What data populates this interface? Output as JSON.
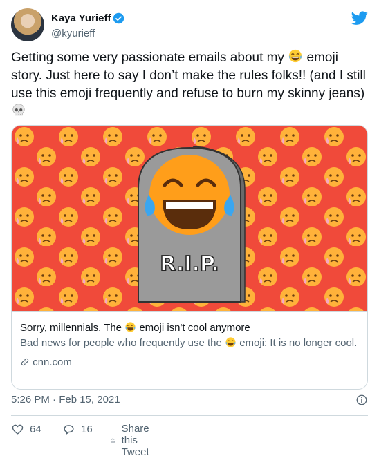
{
  "author": {
    "name": "Kaya Yurieff",
    "handle": "@kyurieff",
    "verified_icon": "verified-badge-icon"
  },
  "platform_icon": "twitter-bird-icon",
  "tweet": {
    "text_part1": "Getting some very passionate emails about my ",
    "text_part2": " emoji story. Just here to say I don’t make the rules folks!! (and I still use this emoji frequently and refuse to burn my skinny jeans) ",
    "emoji1": "face-with-tears-of-joy-emoji",
    "emoji2": "skull-emoji"
  },
  "card": {
    "image_text": "R.I.P.",
    "title_part1": "Sorry, millennials. The ",
    "title_part2": " emoji isn't cool anymore",
    "desc_part1": "Bad news for people who frequently use the ",
    "desc_part2": " emoji: It is no longer cool.",
    "domain": "cnn.com",
    "link_icon": "link-icon"
  },
  "meta": {
    "timestamp": "5:26 PM · Feb 15, 2021",
    "info_icon": "info-icon"
  },
  "actions": {
    "likes": "64",
    "replies": "16",
    "share_label": "Share this Tweet"
  },
  "colors": {
    "brand": "#1d9bf0",
    "card_bg": "#f04a3a",
    "text": "#0f1419",
    "muted": "#536471"
  }
}
